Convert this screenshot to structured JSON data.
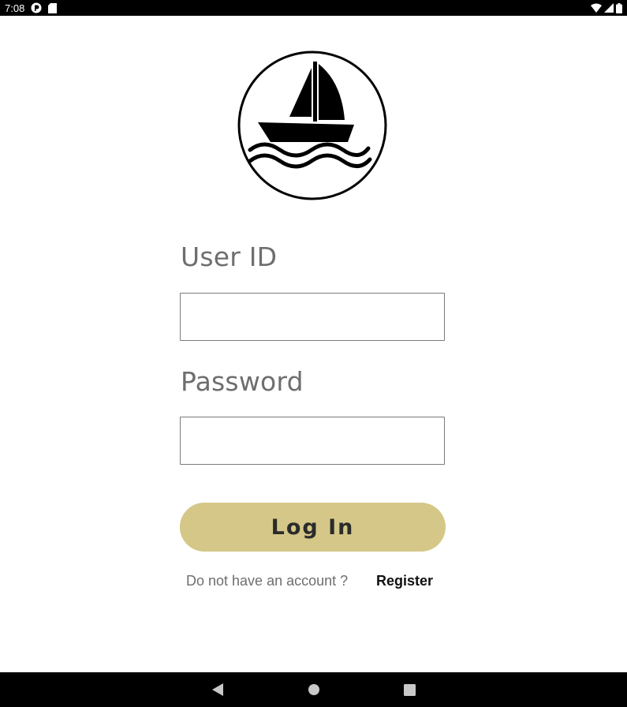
{
  "status_bar": {
    "time": "7:08",
    "left_icons": [
      "app-notification-icon",
      "sd-card-icon"
    ],
    "right_icons": [
      "wifi-icon",
      "cell-signal-icon",
      "battery-icon"
    ]
  },
  "logo": {
    "icon": "sailboat-logo-icon"
  },
  "form": {
    "user_id_label": "User ID",
    "user_id_value": "",
    "password_label": "Password",
    "password_value": "",
    "login_label": "Log In"
  },
  "register": {
    "prompt": "Do not have an account ?",
    "link": "Register"
  },
  "nav_bar": {
    "buttons": [
      "back-icon",
      "home-icon",
      "recents-icon"
    ]
  },
  "colors": {
    "button_bg": "#d4c788",
    "label_text": "#6e6e6e",
    "bar_bg": "#000000"
  }
}
